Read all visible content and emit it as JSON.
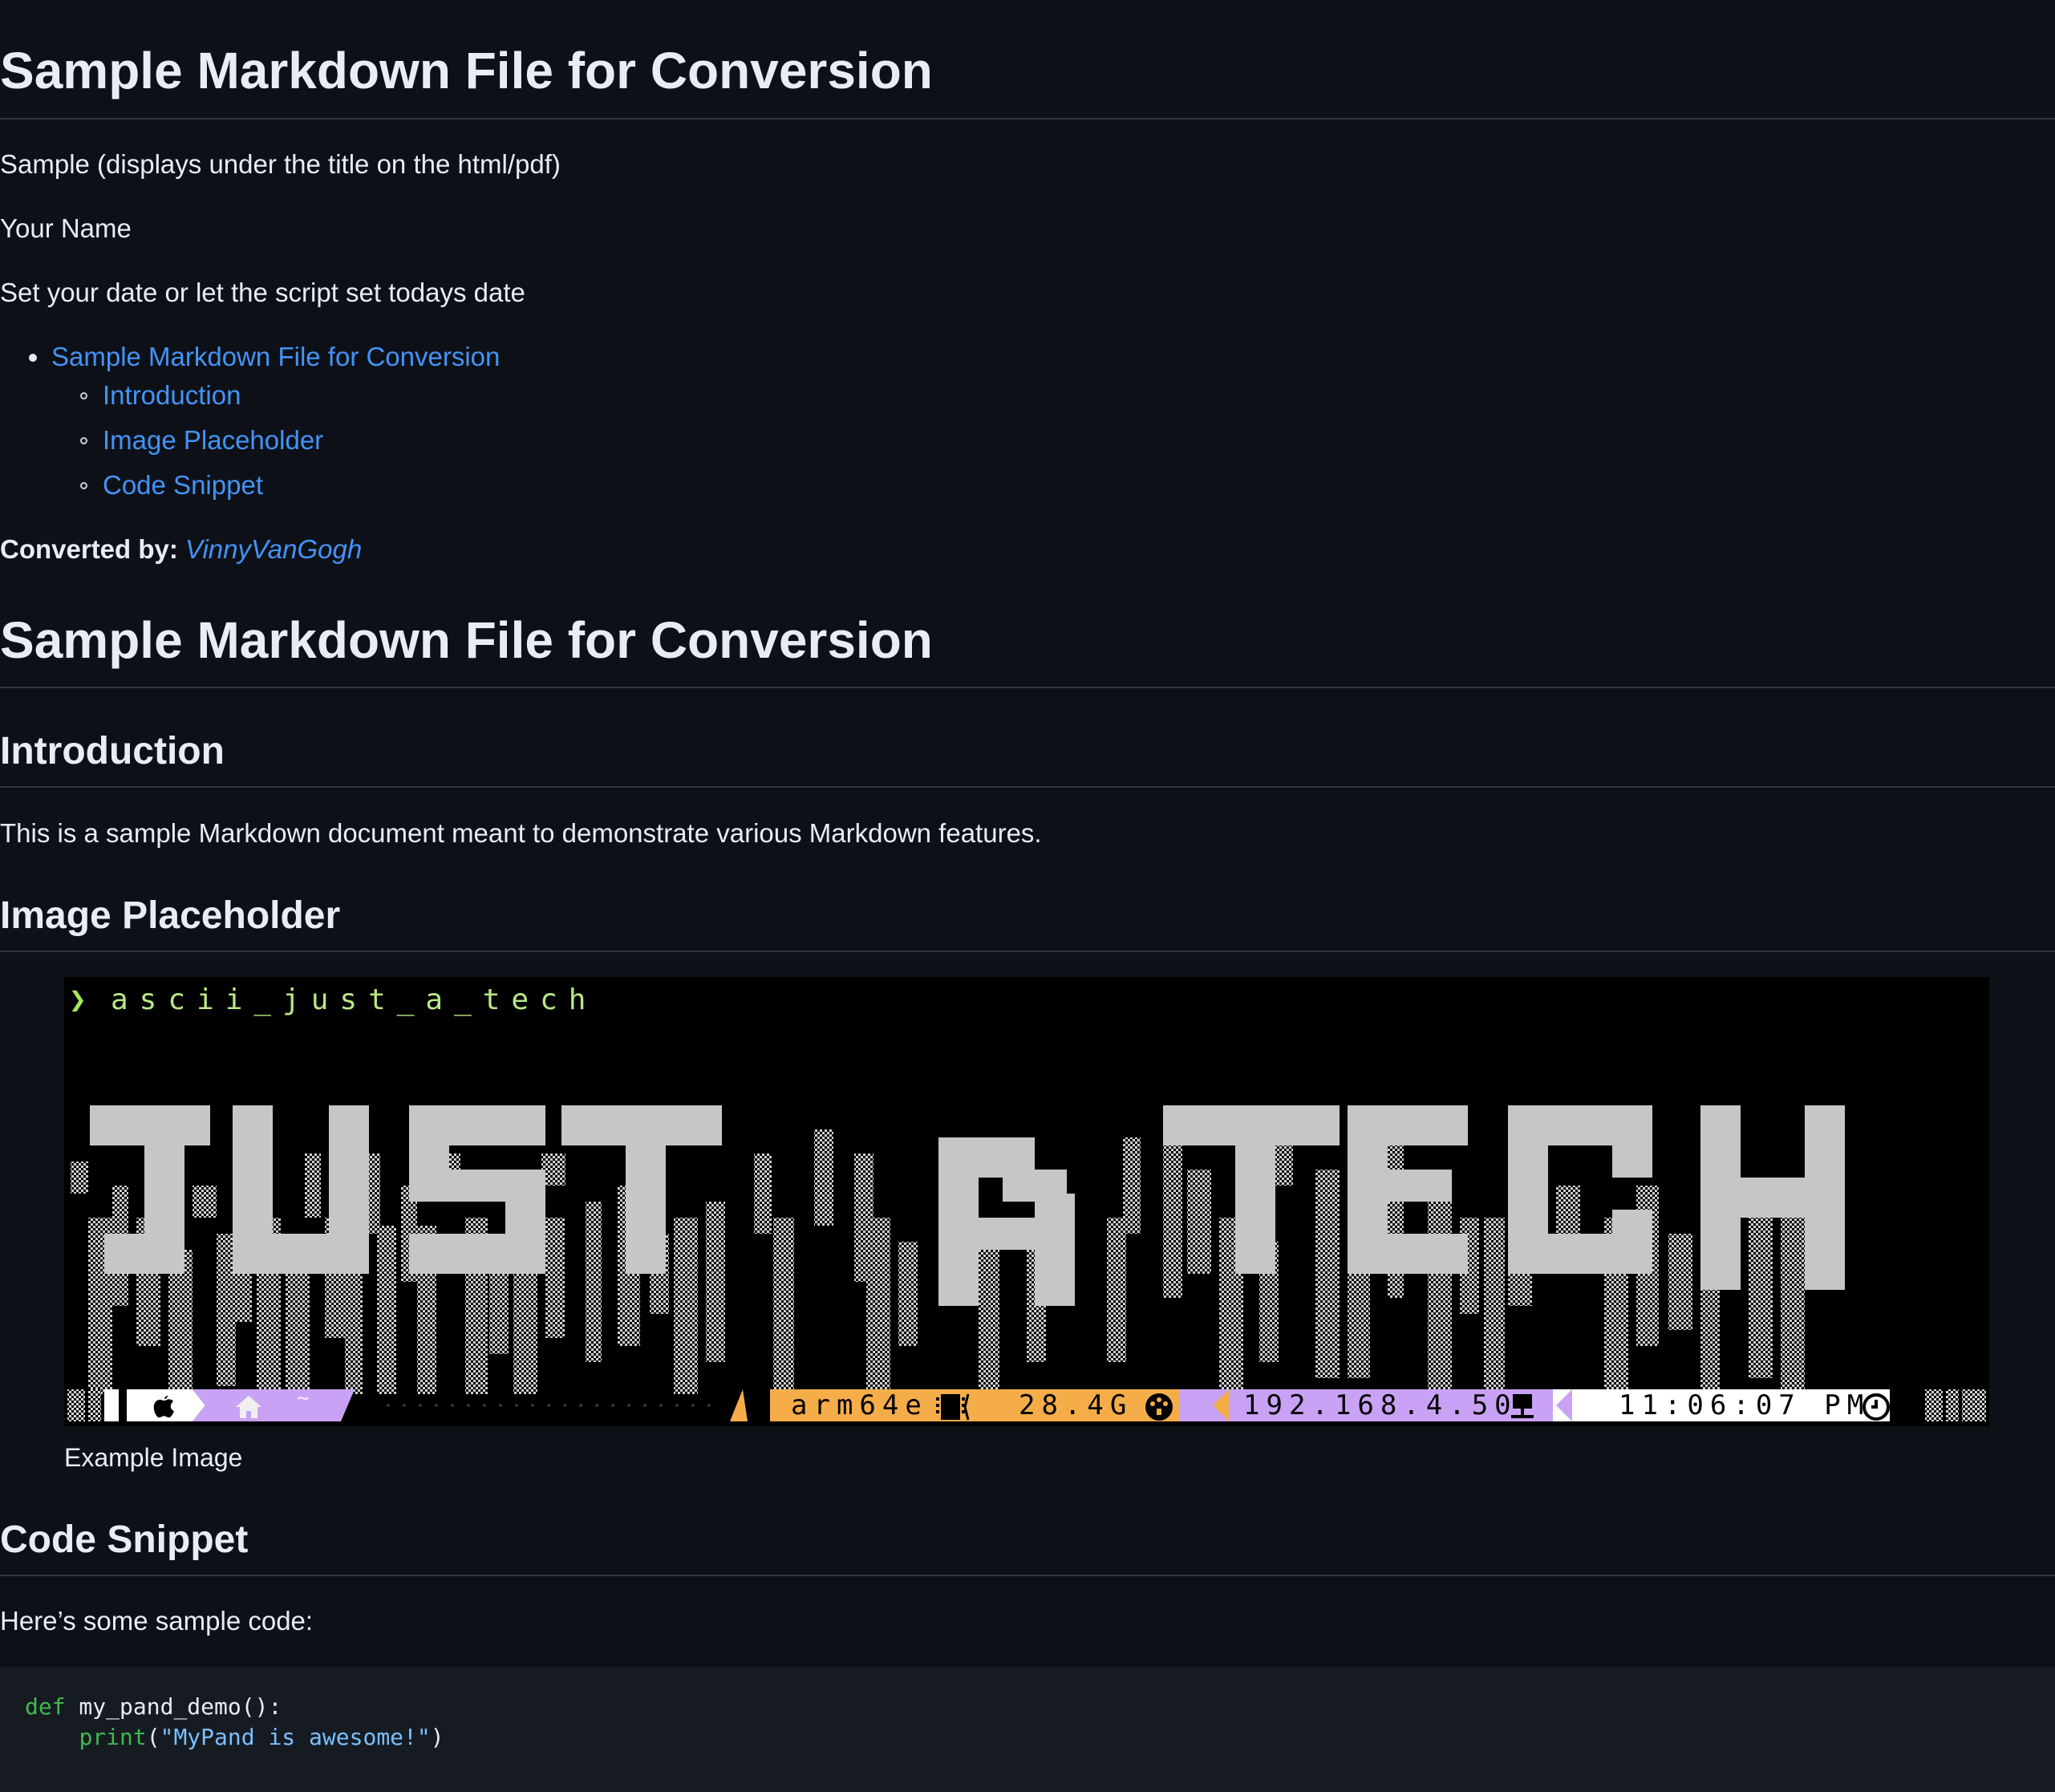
{
  "document": {
    "title": "Sample Markdown File for Conversion",
    "subtitle": "Sample (displays under the title on the html/pdf)",
    "author": "Your Name",
    "date": "Set your date or let the script set todays date",
    "toc": {
      "top": "Sample Markdown File for Conversion",
      "items": [
        "Introduction",
        "Image Placeholder",
        "Code Snippet"
      ]
    },
    "converted_by_label": "Converted by:",
    "converted_by_name": "VinnyVanGogh",
    "heading_main": "Sample Markdown File for Conversion",
    "sections": {
      "introduction": {
        "heading": "Introduction",
        "body": "This is a sample Markdown document meant to demonstrate various Markdown features."
      },
      "image": {
        "heading": "Image Placeholder",
        "caption": "Example Image"
      },
      "code": {
        "heading": "Code Snippet",
        "intro": "Here’s some sample code:",
        "line1_kw": "def",
        "line1_rest": " my_pand_demo():",
        "line2_indent": "    ",
        "line2_fn": "print",
        "line2_open": "(",
        "line2_str": "\"MyPand is awesome!\"",
        "line2_close": ")"
      }
    }
  },
  "terminal_image": {
    "prompt_symbol": "❯",
    "command": "ascii_just_a_tech",
    "banner_text": "JUST A TECH",
    "status": {
      "apple_icon": "apple-icon",
      "home_icon": "home-icon",
      "home_path": "~",
      "arch": "arm64e",
      "memory": "28.4G",
      "ip": "192.168.4.50",
      "time": "11:06:07 PM"
    },
    "colors": {
      "prompt": "#a5e75a",
      "purple": "#c9a2f5",
      "orange": "#f5ad4a",
      "light": "#ffffff",
      "block": "#c6c6c6"
    }
  }
}
